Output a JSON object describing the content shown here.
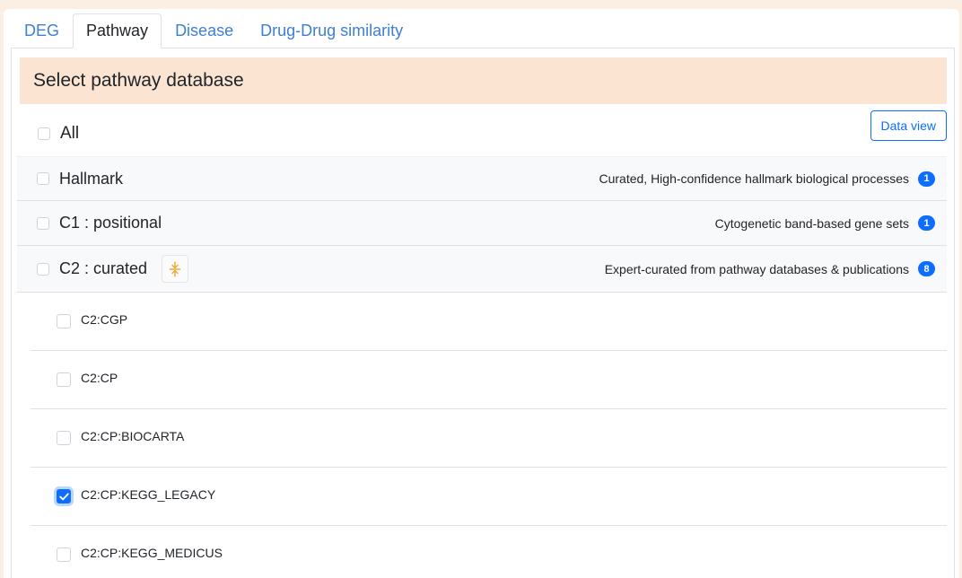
{
  "tabs": [
    "DEG",
    "Pathway",
    "Disease",
    "Drug-Drug similarity"
  ],
  "active_tab": "Pathway",
  "panel": {
    "header": "Select pathway database",
    "all_label": "All",
    "data_view_button": "Data view"
  },
  "groups": [
    {
      "label": "Hallmark",
      "description": "Curated, High-confidence hallmark biological processes",
      "count": "1"
    },
    {
      "label": "C1 : positional",
      "description": "Cytogenetic band-based gene sets",
      "count": "1"
    },
    {
      "label": "C2 : curated",
      "description": "Expert-curated from pathway databases & publications",
      "count": "8"
    }
  ],
  "c2_subsets": [
    {
      "label": "C2:CGP",
      "checked": false
    },
    {
      "label": "C2:CP",
      "checked": false
    },
    {
      "label": "C2:CP:BIOCARTA",
      "checked": false
    },
    {
      "label": "C2:CP:KEGG_LEGACY",
      "checked": true
    },
    {
      "label": "C2:CP:KEGG_MEDICUS",
      "checked": false
    }
  ],
  "colors": {
    "page_background": "#fbeee2",
    "header_background": "#fbe4d2",
    "accent": "#0d6efd",
    "tab_link": "#3d7fd4",
    "collapse_icon": "#f0a830"
  },
  "icons": {
    "collapse": "collapse-arrows-icon",
    "check": "checkmark-icon"
  }
}
